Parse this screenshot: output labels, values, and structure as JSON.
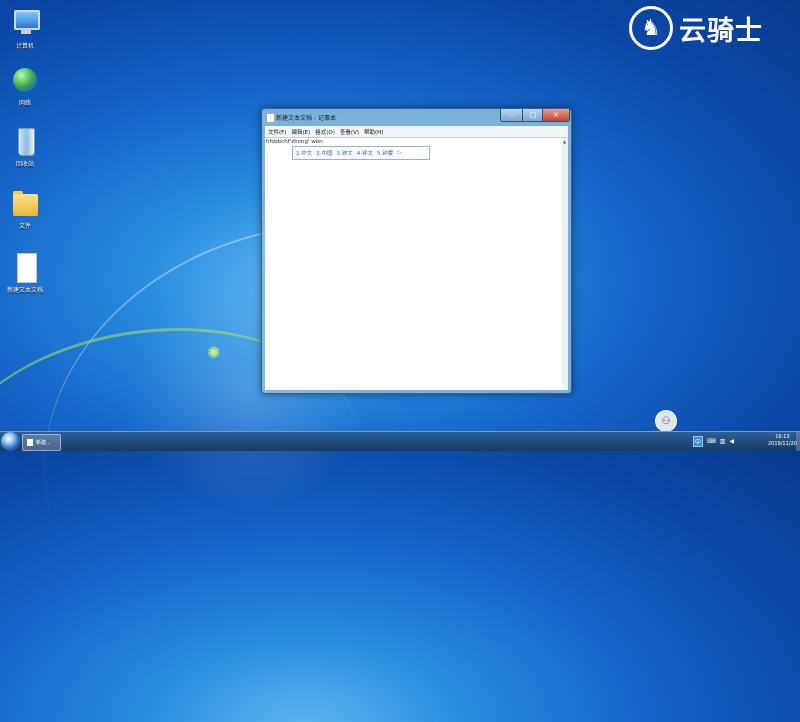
{
  "desktop": {
    "icons": [
      {
        "label": "计算机",
        "icon": "computer-icon"
      },
      {
        "label": "网络",
        "icon": "network-icon"
      },
      {
        "label": "回收站",
        "icon": "recycle-bin-icon"
      },
      {
        "label": "文件",
        "icon": "folder-icon"
      },
      {
        "label": "新建文本文档",
        "icon": "text-document-icon"
      }
    ]
  },
  "brand": {
    "name": "云骑士",
    "icon": "knight-logo-icon"
  },
  "notepad": {
    "title": "新建文本文档 - 记事本",
    "controls": {
      "minimize": "–",
      "maximize": "□",
      "close": "✕"
    },
    "menu": [
      "文件(F)",
      "编辑(E)",
      "格式(O)",
      "查看(V)",
      "帮助(H)"
    ],
    "content": "hfdsbchf'zhong' wen",
    "scroll_up": "▲"
  },
  "ime": {
    "candidates": [
      "1.中文",
      "2.中国",
      "3.钟文",
      "4.钟文",
      "5.钟雯"
    ],
    "next": "▷"
  },
  "taskbar": {
    "task_label": "新建...",
    "tray": {
      "lang": "中",
      "icons": [
        "ime-icon",
        "network-icon",
        "volume-icon"
      ]
    },
    "time": "16:13",
    "date": "2019/11/20"
  },
  "colors": {
    "accent": "#1565c8",
    "taskbar": "#183a66"
  }
}
